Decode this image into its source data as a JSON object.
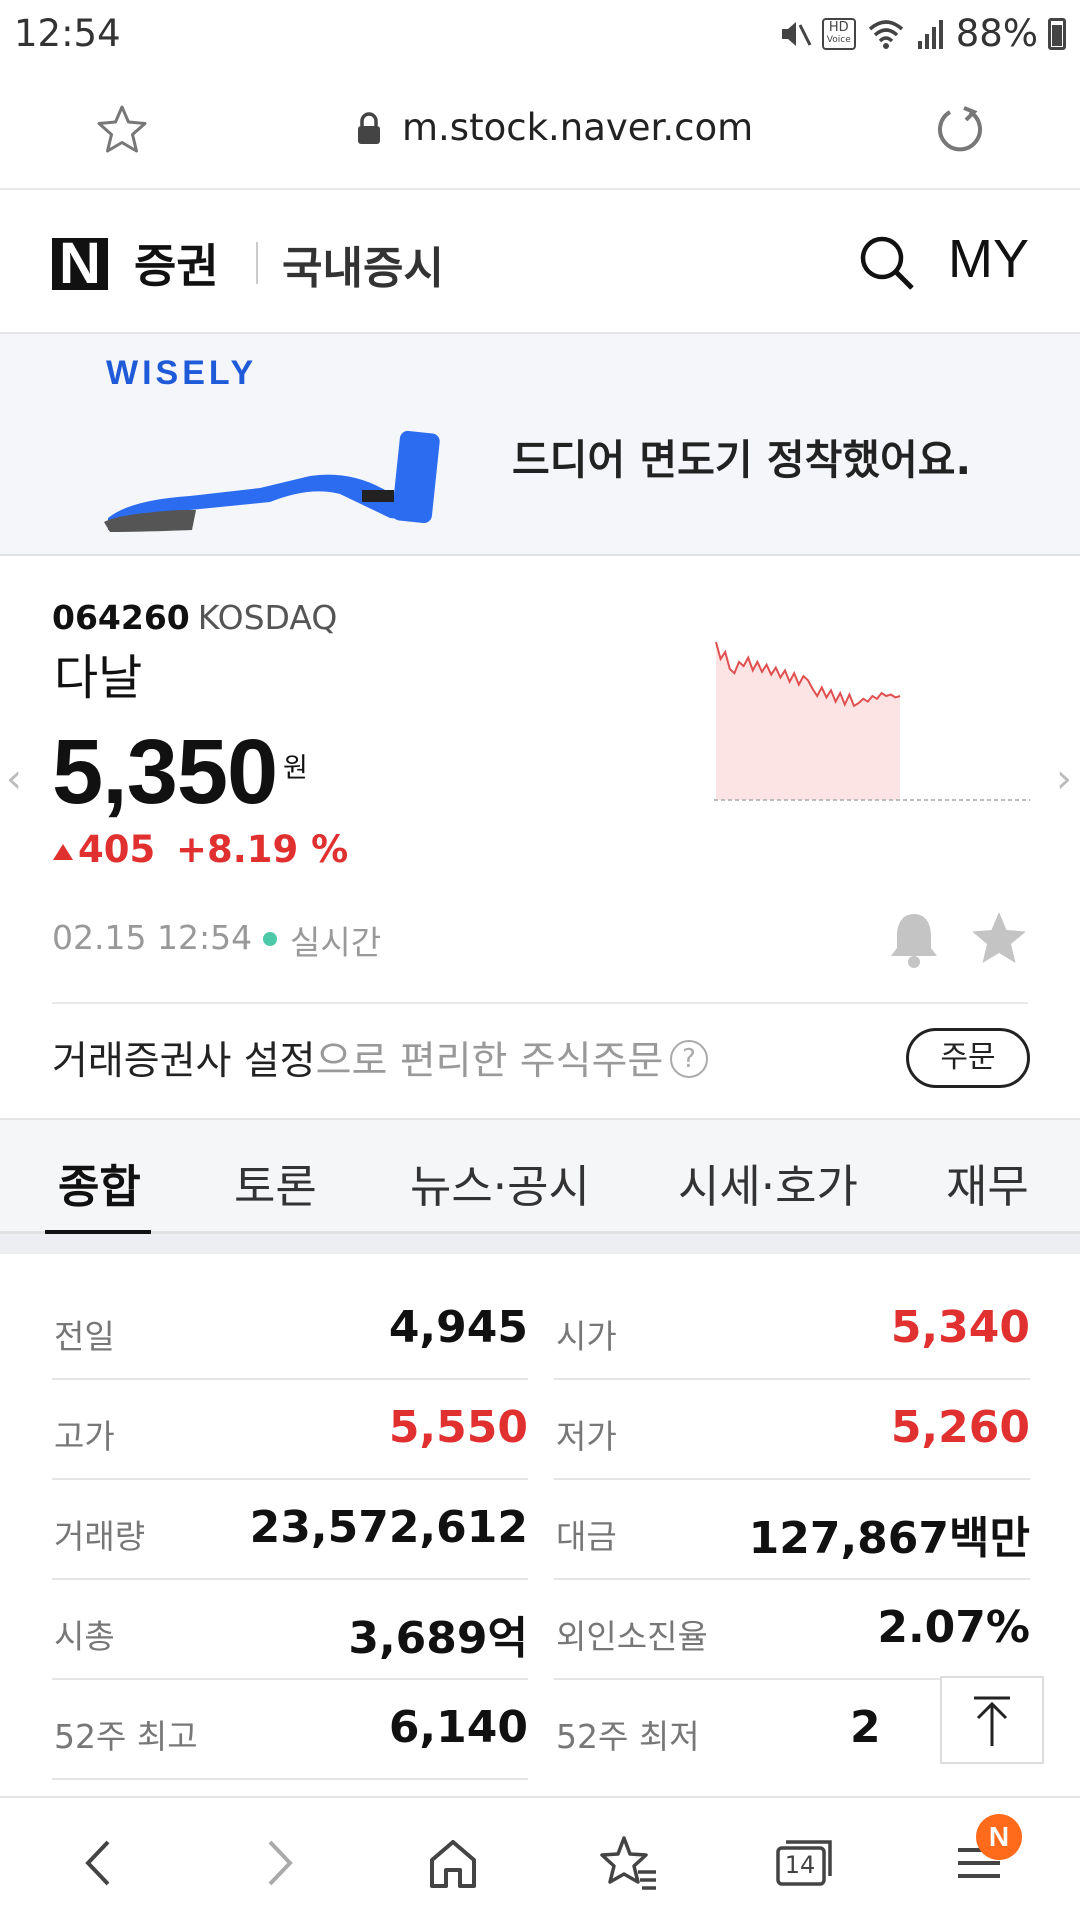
{
  "status_bar": {
    "time": "12:54",
    "hd_label": "HD",
    "voice_label": "Voice",
    "battery": "88%"
  },
  "browser": {
    "url": "m.stock.naver.com"
  },
  "header": {
    "logo": "N",
    "section": "증권",
    "subsection": "국내증시",
    "my_label": "MY"
  },
  "banner": {
    "brand": "WISELY",
    "text": "드디어 면도기 정착했어요."
  },
  "stock": {
    "code": "064260",
    "market": "KOSDAQ",
    "name": "다날",
    "price": "5,350",
    "price_unit": "원",
    "change": "405",
    "change_rate": "+8.19 %",
    "timestamp": "02.15 12:54",
    "realtime_label": "실시간",
    "direction": "up"
  },
  "broker": {
    "highlight": "거래증권사 설정",
    "rest": "으로 편리한 주식주문",
    "help": "?",
    "order_label": "주문"
  },
  "tabs": [
    {
      "label": "종합",
      "active": true
    },
    {
      "label": "토론",
      "active": false
    },
    {
      "label": "뉴스·공시",
      "active": false
    },
    {
      "label": "시세·호가",
      "active": false
    },
    {
      "label": "재무",
      "active": false
    }
  ],
  "stats": [
    {
      "label": "전일",
      "value": "4,945",
      "color": "black"
    },
    {
      "label": "시가",
      "value": "5,340",
      "color": "red"
    },
    {
      "label": "고가",
      "value": "5,550",
      "color": "red"
    },
    {
      "label": "저가",
      "value": "5,260",
      "color": "red"
    },
    {
      "label": "거래량",
      "value": "23,572,612",
      "color": "black"
    },
    {
      "label": "대금",
      "value": "127,867백만",
      "color": "black"
    },
    {
      "label": "시총",
      "value": "3,689억",
      "color": "black"
    },
    {
      "label": "외인소진율",
      "value": "2.07%",
      "color": "black"
    },
    {
      "label": "52주 최고",
      "value": "6,140",
      "color": "black"
    },
    {
      "label": "52주 최저",
      "value": "2",
      "color": "black"
    }
  ],
  "bottom_nav": {
    "tab_count": "14",
    "notification_badge": "N"
  },
  "colors": {
    "up_red": "#e03030",
    "realtime_dot": "#4cc9a8",
    "badge_orange": "#ff6b1a",
    "wisely_blue": "#1f5bd8"
  },
  "intraday_chart": [
    1.0,
    0.88,
    0.93,
    0.81,
    0.78,
    0.86,
    0.83,
    0.89,
    0.8,
    0.86,
    0.79,
    0.84,
    0.77,
    0.82,
    0.75,
    0.8,
    0.72,
    0.78,
    0.7,
    0.76,
    0.73,
    0.67,
    0.62,
    0.68,
    0.61,
    0.66,
    0.58,
    0.64,
    0.56,
    0.63,
    0.55,
    0.57,
    0.6,
    0.58,
    0.62,
    0.6,
    0.64,
    0.62,
    0.63,
    0.61,
    0.62
  ]
}
